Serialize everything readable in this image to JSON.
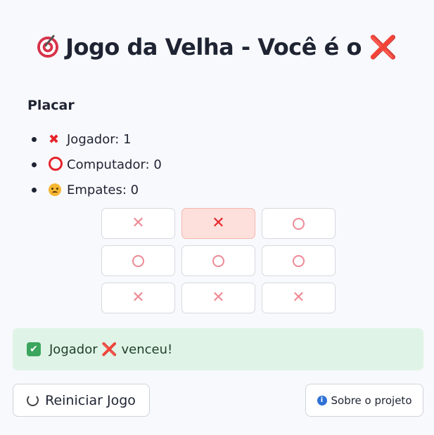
{
  "header": {
    "title": "Jogo da Velha - Você é o",
    "player_symbol": "❌"
  },
  "score": {
    "title": "Placar",
    "items": [
      {
        "icon": "x-mark-icon",
        "label": "Jogador: 1"
      },
      {
        "icon": "circle-icon",
        "label": "Computador: 0"
      },
      {
        "icon": "face-icon",
        "label": "Empates: 0"
      }
    ]
  },
  "board": {
    "cells": [
      "✕",
      "✕",
      "○",
      "○",
      "○",
      "○",
      "✕",
      "✕",
      "✕"
    ],
    "highlighted_cell": 1
  },
  "alert": {
    "prefix": "Jogador",
    "symbol": "❌",
    "suffix": "venceu!"
  },
  "buttons": {
    "restart_label": "Reiniciar Jogo",
    "about_label": "Sobre o projeto"
  },
  "colors": {
    "accent": "#e5242b",
    "success_bg": "#dff4e6",
    "highlight_bg": "#fde0dc"
  }
}
